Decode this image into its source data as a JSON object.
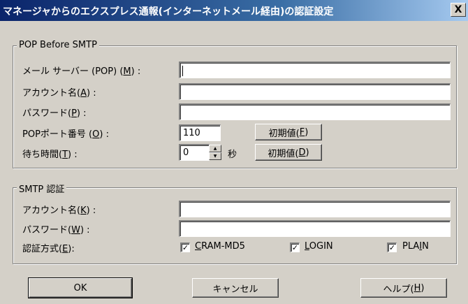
{
  "window": {
    "title": "マネージャからのエクスプレス通報(インターネットメール経由)の認証設定",
    "close_glyph": "X"
  },
  "pop": {
    "legend": "POP Before SMTP",
    "mail_server": {
      "label": "メール サーバー (POP) (",
      "key": "M",
      "suffix": ") :",
      "value": ""
    },
    "account": {
      "label": "アカウント名(",
      "key": "A",
      "suffix": ") :",
      "value": ""
    },
    "password": {
      "label": "パスワード(",
      "key": "P",
      "suffix": ") :",
      "value": ""
    },
    "port": {
      "label": "POPポート番号 (",
      "key": "O",
      "suffix": ") :",
      "value": "110",
      "default_btn": {
        "label": "初期値(",
        "key": "F",
        "suffix": ")"
      }
    },
    "wait": {
      "label": "待ち時間(",
      "key": "T",
      "suffix": ") :",
      "value": "0",
      "unit": "秒",
      "default_btn": {
        "label": "初期値(",
        "key": "D",
        "suffix": ")"
      }
    }
  },
  "smtp": {
    "legend": "SMTP 認証",
    "account": {
      "label": "アカウント名(",
      "key": "K",
      "suffix": ") :",
      "value": ""
    },
    "password": {
      "label": "パスワード(",
      "key": "W",
      "suffix": ") :",
      "value": ""
    },
    "auth": {
      "label": "認証方式(",
      "key": "E",
      "suffix": "):",
      "options": [
        {
          "label_pre": "",
          "key": "C",
          "label_post": "RAM-MD5",
          "checked": true
        },
        {
          "label_pre": "",
          "key": "L",
          "label_post": "OGIN",
          "checked": true
        },
        {
          "label_pre": "PLA",
          "key": "I",
          "label_post": "N",
          "checked": true
        }
      ]
    }
  },
  "buttons": {
    "ok": "OK",
    "cancel": "キャンセル",
    "help": {
      "label": "ヘルプ(",
      "key": "H",
      "suffix": ")"
    }
  },
  "check_glyph": "✓",
  "spin_up": "▲",
  "spin_down": "▼"
}
